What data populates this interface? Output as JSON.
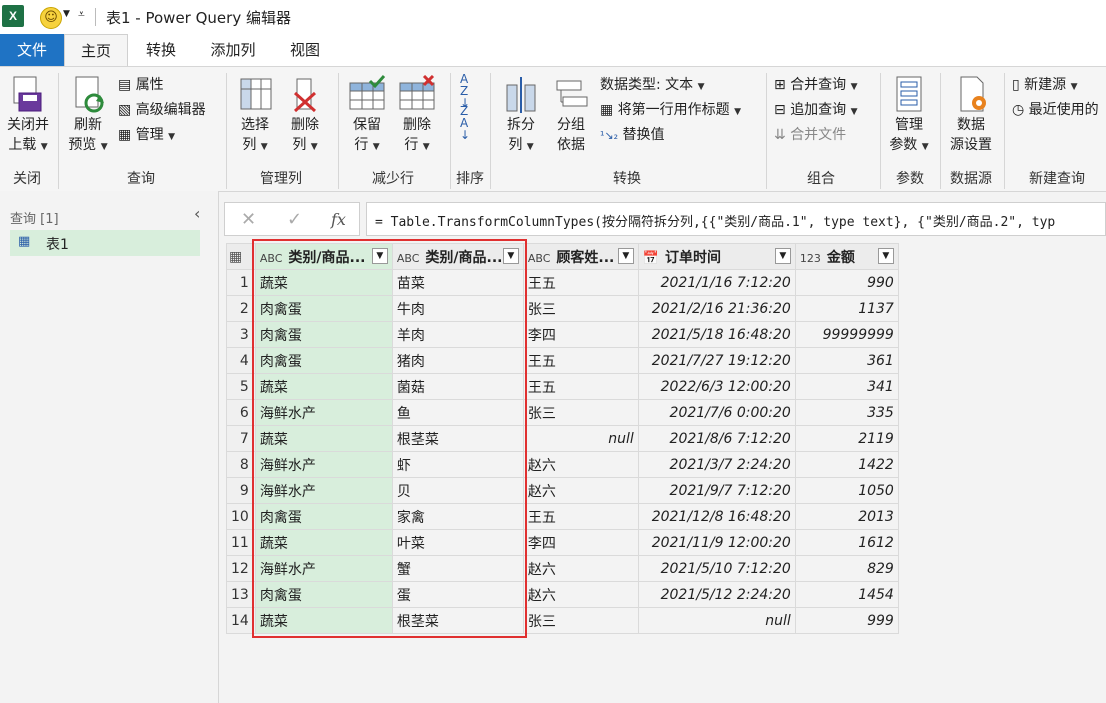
{
  "title_bar": {
    "excel_label": "X",
    "title": "表1 - Power Query 编辑器"
  },
  "tabs": [
    {
      "label": "文件"
    },
    {
      "label": "主页"
    },
    {
      "label": "转换"
    },
    {
      "label": "添加列"
    },
    {
      "label": "视图"
    }
  ],
  "ribbon": {
    "close": {
      "btn1": "关闭并",
      "btn2": "上载",
      "group": "关闭"
    },
    "query": {
      "refresh1": "刷新",
      "refresh2": "预览",
      "properties": "属性",
      "advanced_editor": "高级编辑器",
      "manage": "管理",
      "group": "查询"
    },
    "manage_columns": {
      "choose1": "选择",
      "choose2": "列",
      "remove1": "删除",
      "remove2": "列",
      "group": "管理列"
    },
    "reduce_rows": {
      "keep1": "保留",
      "keep2": "行",
      "remove1": "删除",
      "remove2": "行",
      "group": "减少行"
    },
    "sort": {
      "group": "排序"
    },
    "transform": {
      "split1": "拆分",
      "split2": "列",
      "groupby1": "分组",
      "groupby2": "依据",
      "datatype": "数据类型: 文本",
      "first_row": "将第一行用作标题",
      "replace": "替换值",
      "group": "转换"
    },
    "combine": {
      "merge": "合并查询",
      "append": "追加查询",
      "combine_files": "合并文件",
      "group": "组合"
    },
    "params": {
      "btn1": "管理",
      "btn2": "参数",
      "group": "参数"
    },
    "datasource": {
      "btn1": "数据",
      "btn2": "源设置",
      "group": "数据源"
    },
    "new_query": {
      "new_source": "新建源",
      "recent": "最近使用的",
      "group": "新建查询"
    }
  },
  "queries_pane": {
    "header": "查询 [1]",
    "items": [
      {
        "label": "表1"
      }
    ]
  },
  "formula_bar": {
    "fx": "fx",
    "formula": "= Table.TransformColumnTypes(按分隔符拆分列,{{\"类别/商品.1\", type text}, {\"类别/商品.2\", typ"
  },
  "grid": {
    "headers": [
      {
        "type": "ABC",
        "label": "类别/商品..."
      },
      {
        "type": "ABC",
        "label": "类别/商品..."
      },
      {
        "type": "ABC",
        "label": "顾客姓..."
      },
      {
        "type": "date",
        "label": "订单时间"
      },
      {
        "type": "123",
        "label": "金额"
      }
    ],
    "rows": [
      [
        "1",
        "蔬菜",
        "苗菜",
        "王五",
        "2021/1/16 7:12:20",
        "990"
      ],
      [
        "2",
        "肉禽蛋",
        "牛肉",
        "张三",
        "2021/2/16 21:36:20",
        "1137"
      ],
      [
        "3",
        "肉禽蛋",
        "羊肉",
        "李四",
        "2021/5/18 16:48:20",
        "99999999"
      ],
      [
        "4",
        "肉禽蛋",
        "猪肉",
        "王五",
        "2021/7/27 19:12:20",
        "361"
      ],
      [
        "5",
        "蔬菜",
        "菌菇",
        "王五",
        "2022/6/3 12:00:20",
        "341"
      ],
      [
        "6",
        "海鲜水产",
        "鱼",
        "张三",
        "2021/7/6 0:00:20",
        "335"
      ],
      [
        "7",
        "蔬菜",
        "根茎菜",
        "null",
        "2021/8/6 7:12:20",
        "2119"
      ],
      [
        "8",
        "海鲜水产",
        "虾",
        "赵六",
        "2021/3/7 2:24:20",
        "1422"
      ],
      [
        "9",
        "海鲜水产",
        "贝",
        "赵六",
        "2021/9/7 7:12:20",
        "1050"
      ],
      [
        "10",
        "肉禽蛋",
        "家禽",
        "王五",
        "2021/12/8 16:48:20",
        "2013"
      ],
      [
        "11",
        "蔬菜",
        "叶菜",
        "李四",
        "2021/11/9 12:00:20",
        "1612"
      ],
      [
        "12",
        "海鲜水产",
        "蟹",
        "赵六",
        "2021/5/10 7:12:20",
        "829"
      ],
      [
        "13",
        "肉禽蛋",
        "蛋",
        "赵六",
        "2021/5/12 2:24:20",
        "1454"
      ],
      [
        "14",
        "蔬菜",
        "根茎菜",
        "张三",
        "null",
        "999"
      ]
    ]
  }
}
